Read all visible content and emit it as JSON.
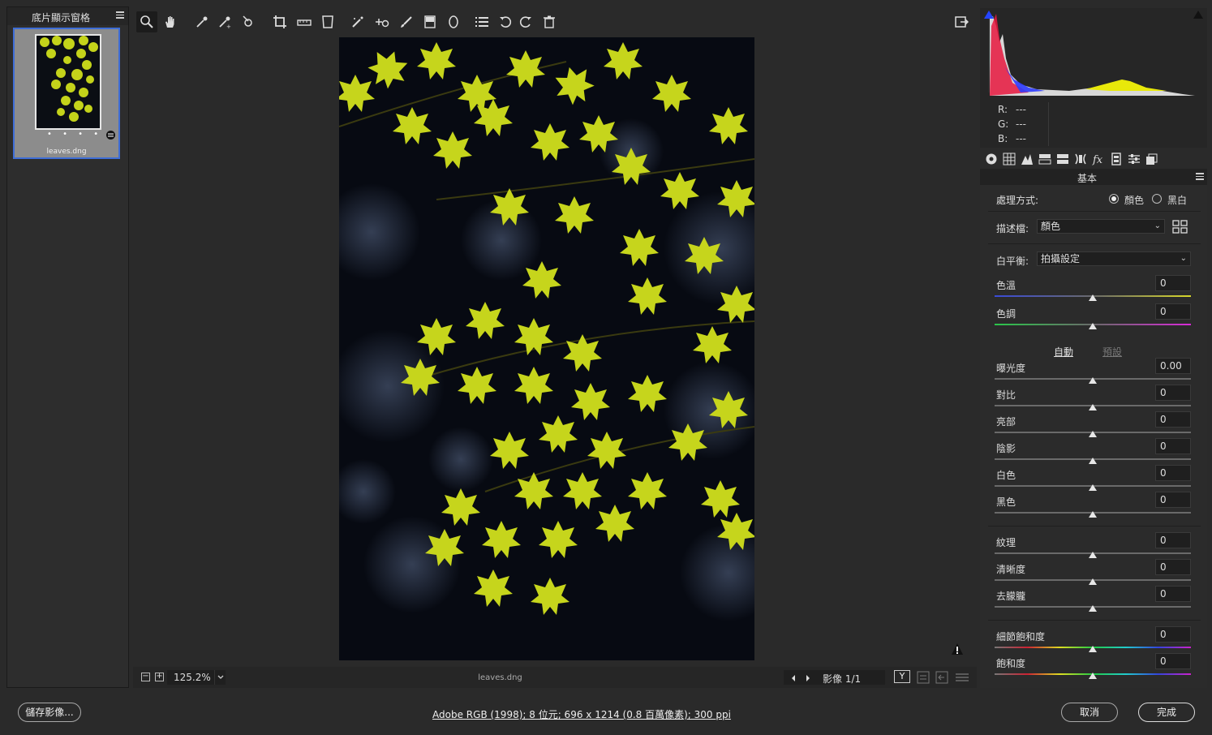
{
  "filmstrip": {
    "title": "底片顯示窗格",
    "thumb_rating": "• • • • •",
    "thumb_name": "leaves.dng"
  },
  "toolbar": {
    "tools": [
      "zoom-tool",
      "hand-tool",
      "white-balance-tool",
      "color-sampler-tool",
      "targeted-adjustment-tool",
      "crop-tool",
      "straighten-tool",
      "transform-tool",
      "spot-removal-tool",
      "red-eye-tool",
      "adjustment-brush",
      "graduated-filter",
      "radial-filter",
      "preferences",
      "rotate-left",
      "rotate-right",
      "trash"
    ]
  },
  "status": {
    "zoom": "125.2%",
    "zoom_minus": "−",
    "zoom_plus": "+",
    "file_name": "leaves.dng",
    "image_count": "影像 1/1",
    "view_mode": "Y"
  },
  "rgb": {
    "r_label": "R:",
    "g_label": "G:",
    "b_label": "B:",
    "r": "---",
    "g": "---",
    "b": "---"
  },
  "basic": {
    "title": "基本",
    "treatment_label": "處理方式:",
    "color_option": "顏色",
    "bw_option": "黑白",
    "profile_label": "描述檔:",
    "profile_value": "顏色",
    "wb_label": "白平衡:",
    "wb_value": "拍攝設定",
    "auto": "自動",
    "default": "預設",
    "sliders": [
      {
        "label": "色溫",
        "value": "0"
      },
      {
        "label": "色調",
        "value": "0"
      },
      {
        "label": "曝光度",
        "value": "0.00"
      },
      {
        "label": "對比",
        "value": "0"
      },
      {
        "label": "亮部",
        "value": "0"
      },
      {
        "label": "陰影",
        "value": "0"
      },
      {
        "label": "白色",
        "value": "0"
      },
      {
        "label": "黑色",
        "value": "0"
      },
      {
        "label": "紋理",
        "value": "0"
      },
      {
        "label": "清晰度",
        "value": "0"
      },
      {
        "label": "去朦朧",
        "value": "0"
      },
      {
        "label": "細節飽和度",
        "value": "0"
      },
      {
        "label": "飽和度",
        "value": "0"
      }
    ]
  },
  "footer": {
    "save": "儲存影像...",
    "workflow": "Adobe RGB (1998); 8 位元; 696 x 1214 (0.8 百萬像素); 300 ppi",
    "cancel": "取消",
    "done": "完成"
  },
  "colors": {
    "accent": "#3e6dd6",
    "leaf": "#c8d81a",
    "background": "#2a2a2a"
  }
}
